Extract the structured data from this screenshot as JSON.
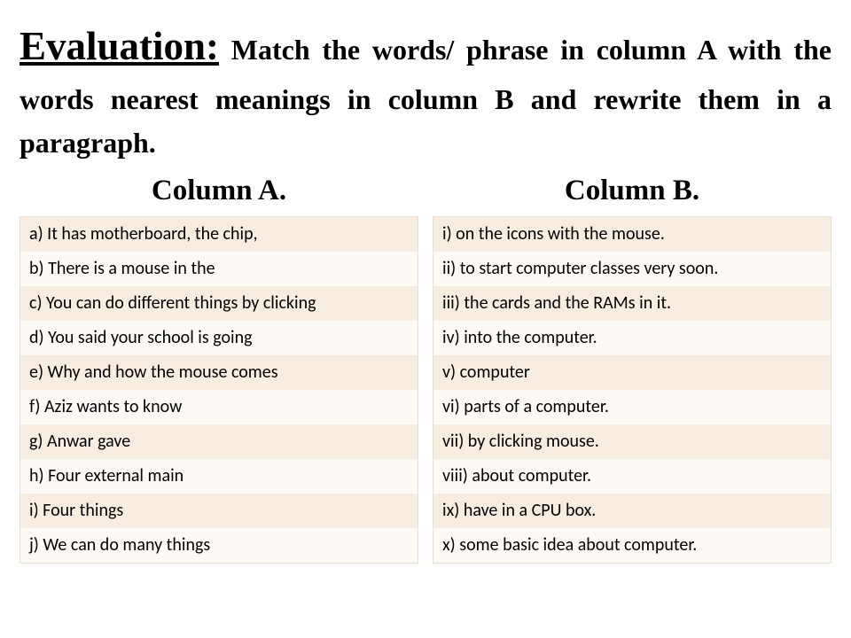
{
  "heading": {
    "lead": "Evaluation:",
    "rest": " Match the words/ phrase in column A with the words nearest meanings in column B and rewrite them in a paragraph."
  },
  "columnA": {
    "title": "Column A.",
    "rows": [
      "a) It has motherboard, the chip,",
      "b) There is a mouse in the",
      "c) You can do different things by clicking",
      "d) You said your school is going",
      "e) Why and how the mouse comes",
      "f) Aziz wants to know",
      "g) Anwar gave",
      "h) Four external main",
      "i) Four things",
      "j) We can do many things"
    ]
  },
  "columnB": {
    "title": "Column B.",
    "rows": [
      "i) on the icons with the mouse.",
      "ii) to start computer classes very soon.",
      "iii) the cards and the RAMs in it.",
      "iv) into the computer.",
      "v) computer",
      "vi) parts of a computer.",
      "vii) by clicking mouse.",
      "viii) about computer.",
      "ix) have in a CPU box.",
      "x) some basic idea about computer."
    ]
  }
}
